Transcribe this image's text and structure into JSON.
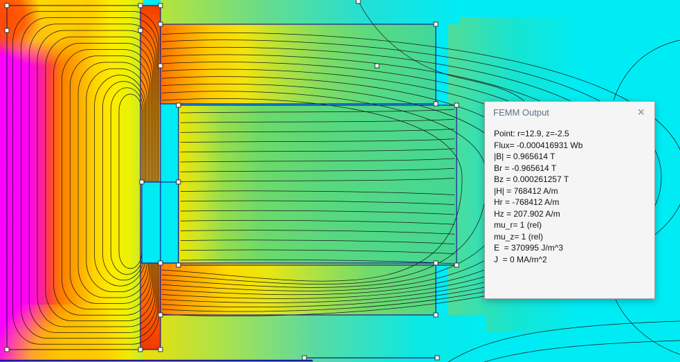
{
  "output_window": {
    "title": "FEMM Output",
    "close_glyph": "×",
    "lines": [
      "Point: r=12.9, z=-2.5",
      "Flux= -0.000416931 Wb",
      "|B| = 0.965614 T",
      "Br = -0.965614 T",
      "Bz = 0.000261257 T",
      "|H| = 768412 A/m",
      "Hr = -768412 A/m",
      "Hz = 207.902 A/m",
      "mu_r= 1 (rel)",
      "mu_z= 1 (rel)",
      "E  = 370995 J/m^3",
      "J  = 0 MA/m^2"
    ]
  },
  "palette": {
    "background_cyan": "#00ecf4",
    "field_magenta": "#ff00ff",
    "field_red": "#ff4040",
    "field_orange": "#ff8800",
    "field_yellow": "#ffe000",
    "field_green": "#58d87e",
    "geometry_blue": "#1a1a92"
  }
}
